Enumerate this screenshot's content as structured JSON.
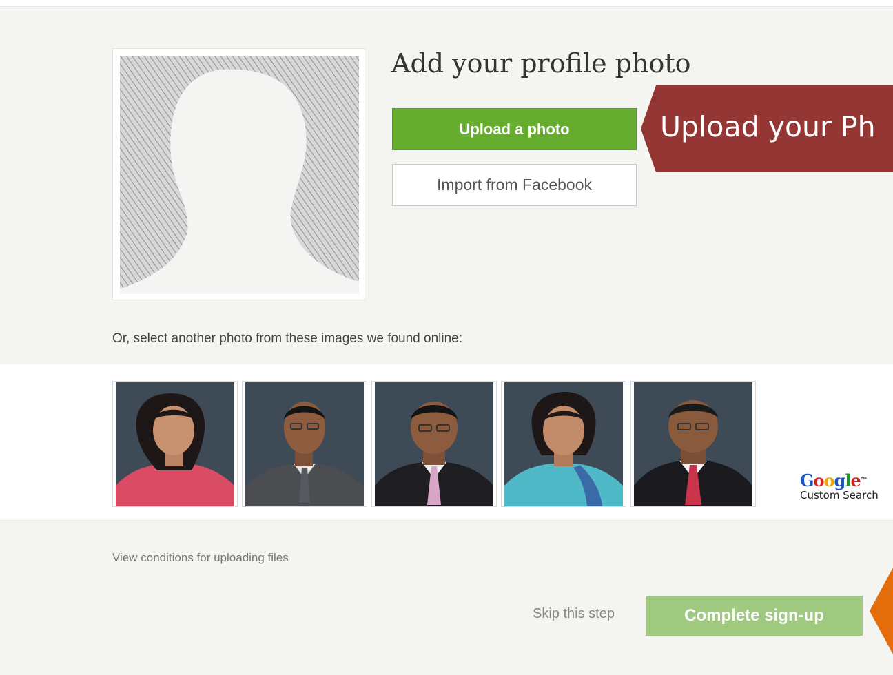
{
  "heading": "Add your profile photo",
  "actions": {
    "upload_label": "Upload a photo",
    "facebook_label": "Import from Facebook"
  },
  "callouts": {
    "upload_text": "Upload your Ph",
    "upload_color": "#943634",
    "complete_color": "#e46c0a"
  },
  "suggestions": {
    "intro": "Or, select another photo from these images we found online:",
    "photos": [
      {
        "id": "photo-1",
        "attire": "red-saree"
      },
      {
        "id": "photo-2",
        "attire": "grey-suit"
      },
      {
        "id": "photo-3",
        "attire": "dark-suit-pink-tie"
      },
      {
        "id": "photo-4",
        "attire": "blue-saree"
      },
      {
        "id": "photo-5",
        "attire": "dark-suit-red-tie"
      }
    ],
    "provider_word": "Google",
    "provider_tm": "™",
    "provider_sub": "Custom Search"
  },
  "footer": {
    "conditions_link": "View conditions for uploading files",
    "skip_label": "Skip this step",
    "complete_label": "Complete sign-up"
  },
  "colors": {
    "background": "#f4f4f0",
    "upload_button": "#66ad30",
    "complete_button": "#9ec97e"
  }
}
